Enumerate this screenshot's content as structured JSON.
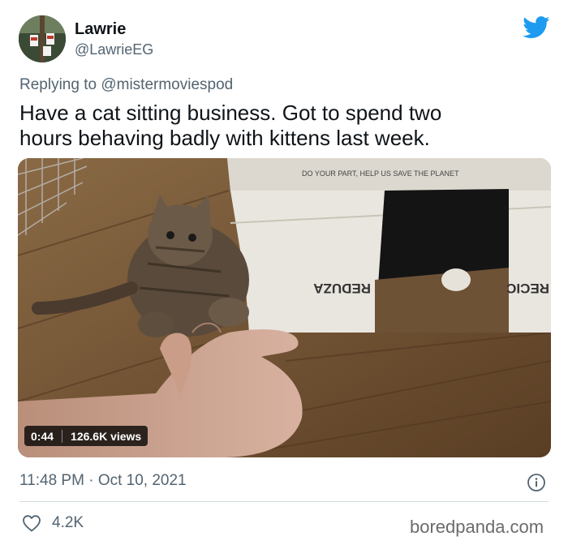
{
  "author": {
    "name": "Lawrie",
    "handle": "@LawrieEG"
  },
  "reply": {
    "prefix": "Replying to",
    "handle": "@mistermoviespod"
  },
  "tweet": {
    "text": "Have a cat sitting business. Got to spend two\nhours behaving badly with kittens last week."
  },
  "media": {
    "box_text_top": "DO YOUR PART, HELP US SAVE THE PLANET",
    "box_text_mirror_1": "REDUZA",
    "box_text_mirror_2": "RECIC",
    "duration": "0:44",
    "views": "126.6K views"
  },
  "meta": {
    "time": "11:48 PM",
    "separator": "·",
    "date": "Oct 10, 2021"
  },
  "engagement": {
    "likes": "4.2K"
  },
  "watermark": "boredpanda.com",
  "colors": {
    "twitter_blue": "#1d9bf0",
    "text_primary": "#0f1419",
    "text_secondary": "#536471",
    "divider": "#cfd9de"
  },
  "icons": {
    "brand": "twitter-bird-icon",
    "info": "info-icon",
    "like": "heart-icon"
  }
}
